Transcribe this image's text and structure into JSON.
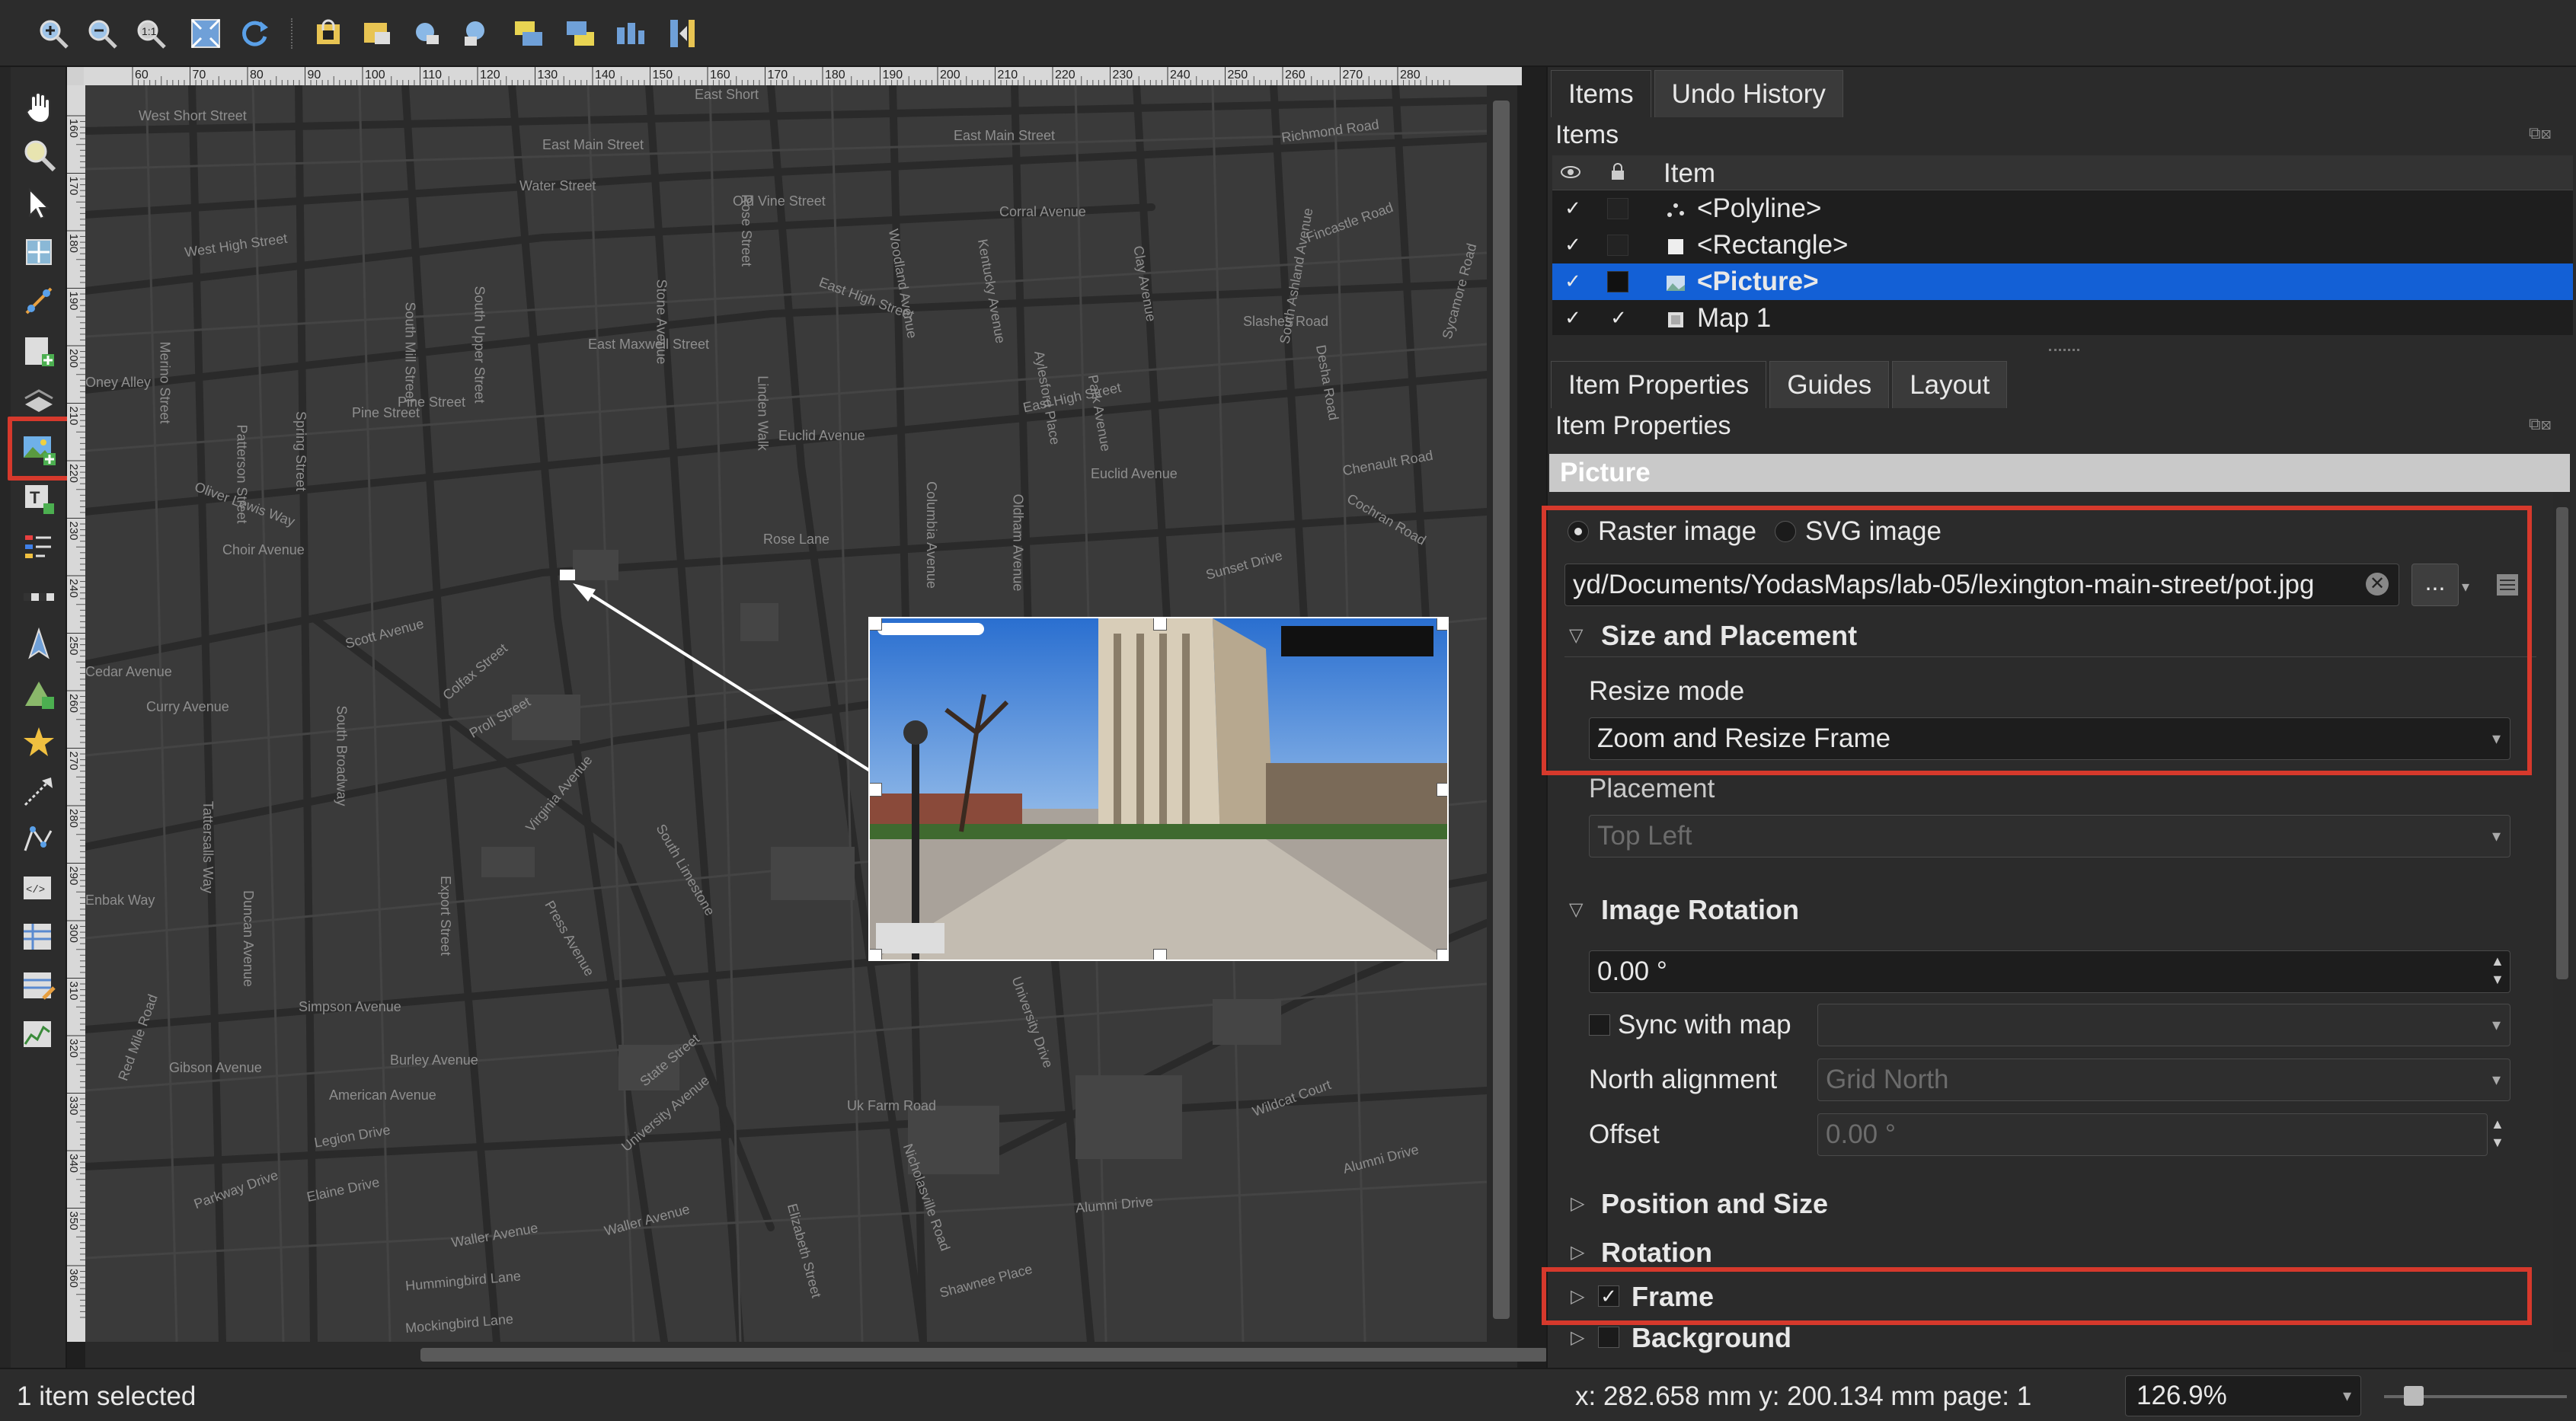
{
  "toolbar": {
    "icons": [
      "zoom-in-icon",
      "zoom-out-icon",
      "zoom-full-icon",
      "zoom-actual-icon",
      "refresh-icon",
      "lock-items-icon",
      "unlock-items-icon",
      "group-icon",
      "ungroup-icon",
      "raise-icon",
      "lower-icon",
      "align-icon",
      "distribute-icon"
    ]
  },
  "toolbox": {
    "icons": [
      "pan-icon",
      "zoom-icon",
      "select-icon",
      "move-content-icon",
      "edit-nodes-icon",
      "add-map-icon",
      "add-3d-map-icon",
      "add-picture-icon",
      "add-label-icon",
      "add-legend-icon",
      "add-scalebar-icon",
      "add-north-arrow-icon",
      "add-shape-icon",
      "add-marker-icon",
      "add-arrow-icon",
      "add-polygon-icon",
      "add-html-icon",
      "add-attribute-table-icon",
      "add-fixed-table-icon",
      "add-elevation-profile-icon"
    ]
  },
  "ruler": {
    "h_ticks": [
      "60",
      "70",
      "80",
      "90",
      "100",
      "110",
      "120",
      "130",
      "140",
      "150",
      "160",
      "170",
      "180",
      "190",
      "200",
      "210",
      "220",
      "230",
      "240",
      "250",
      "260",
      "270",
      "280"
    ],
    "v_ticks": [
      "160",
      "170",
      "180",
      "190",
      "200",
      "210",
      "220",
      "230",
      "240",
      "250",
      "260",
      "270",
      "280",
      "290",
      "300",
      "310",
      "320",
      "330",
      "340",
      "350",
      "360"
    ]
  },
  "map": {
    "street_labels": [
      "West Short Street",
      "East Short",
      "Richmond Road",
      "East Main Street",
      "East Main Street",
      "Water Street",
      "Old Vine Street",
      "West High Street",
      "Corral Avenue",
      "Fincastle Road",
      "East High Street",
      "South Upper Street",
      "South Mill Street",
      "Merino Street",
      "Slashes Road",
      "East Maxwell Street",
      "Oney Alley",
      "Pine Street",
      "Patterson Street",
      "Spring Street",
      "Pine Street",
      "Linden Walk",
      "East High Street",
      "Euclid Avenue",
      "Euclid Avenue",
      "Chenault Road",
      "Oliver Lewis Way",
      "Choir Avenue",
      "Rose Lane",
      "Cochran Road",
      "Sunset Drive",
      "Scott Avenue",
      "Colfax Street",
      "Curry Avenue",
      "Proll Street",
      "Virginia Avenue",
      "Enbak Way",
      "Simpson Avenue",
      "Burley Avenue",
      "Gibson Avenue",
      "American Avenue",
      "Legion Drive",
      "Elaine Drive",
      "Parkway Drive",
      "Waller Avenue",
      "Waller Avenue",
      "Uk Farm Road",
      "Wildcat Court",
      "Alumni Drive",
      "Alumni Drive",
      "Hummingbird Lane",
      "Mockingbird Lane",
      "Shawnee Place",
      "University Drive",
      "Nicholasville Road",
      "Elizabeth Street",
      "State Street",
      "University Avenue",
      "Press Avenue",
      "Rose Street",
      "South Limestone",
      "Woodland Avenue",
      "Kentucky Avenue",
      "Clay Avenue",
      "South Ashland Avenue",
      "Sycamore Road",
      "Desha Road",
      "Park Avenue",
      "Aylesford Place",
      "Oldham Avenue",
      "Columbia Avenue",
      "Export Street",
      "Duncan Avenue",
      "Red Mile Road",
      "South Broadway",
      "Tattersalls Way",
      "Cedar Avenue",
      "Stone Avenue"
    ]
  },
  "items_panel": {
    "tabs": [
      "Items",
      "Undo History"
    ],
    "title": "Items",
    "column": "Item",
    "rows": [
      {
        "name": "<Polyline>",
        "visible": "✓",
        "locked": ""
      },
      {
        "name": "<Rectangle>",
        "visible": "✓",
        "locked": ""
      },
      {
        "name": "<Picture>",
        "visible": "✓",
        "locked": ""
      },
      {
        "name": "Map 1",
        "visible": "✓",
        "locked": "✓"
      }
    ]
  },
  "props_panel": {
    "tabs": [
      "Item Properties",
      "Guides",
      "Layout"
    ],
    "title": "Item Properties",
    "section": "Picture",
    "raster_label": "Raster image",
    "svg_label": "SVG image",
    "path": "yd/Documents/YodasMaps/lab-05/lexington-main-street/pot.jpg",
    "browse_label": "...",
    "size_group": "Size and Placement",
    "resize_label": "Resize mode",
    "resize_value": "Zoom and Resize Frame",
    "placement_label": "Placement",
    "placement_value": "Top Left",
    "rotation_group": "Image Rotation",
    "rotation_value": "0.00 °",
    "sync_label": "Sync with map",
    "north_label": "North alignment",
    "north_value": "Grid North",
    "offset_label": "Offset",
    "offset_value": "0.00 °",
    "position_group": "Position and Size",
    "rotation_section": "Rotation",
    "frame_group": "Frame",
    "background_group": "Background"
  },
  "status": {
    "selection": "1 item selected",
    "coords": "x: 282.658 mm  y: 200.134 mm  page: 1",
    "zoom": "126.9%"
  },
  "colors": {
    "accent": "#1360d6",
    "highlight_red": "#d6392c",
    "map_bg": "#3a3a3a"
  }
}
